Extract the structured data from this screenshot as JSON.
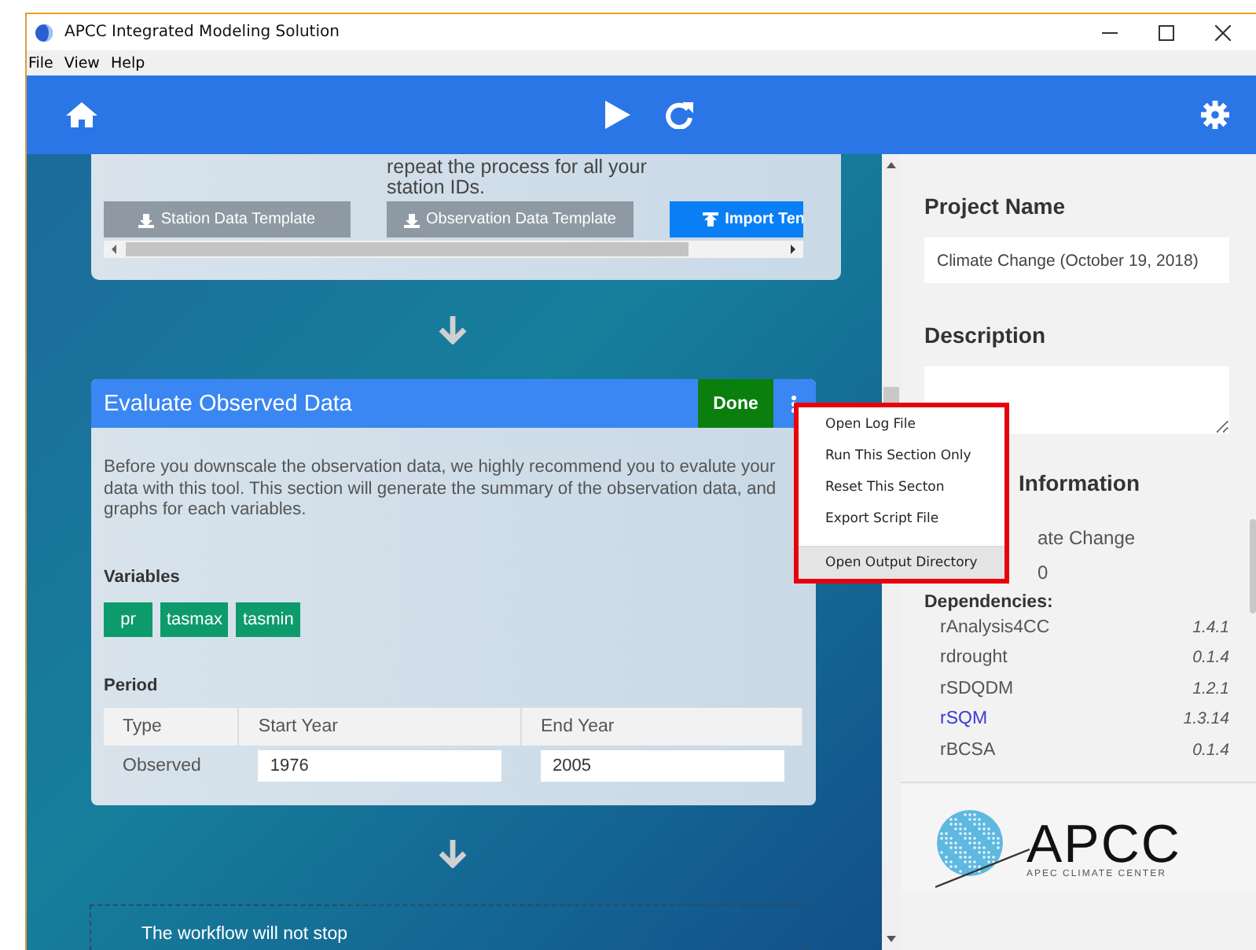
{
  "window": {
    "title": "APCC Integrated Modeling Solution"
  },
  "menu_bar": [
    "File",
    "View",
    "Help"
  ],
  "workflow": {
    "top_card": {
      "text": "repeat the process for all your station IDs.",
      "buttons": [
        {
          "label": "Station Data Template",
          "disabled": true
        },
        {
          "label": "Observation Data Template",
          "disabled": true
        },
        {
          "label": "Import Ten",
          "disabled": false
        }
      ]
    },
    "section": {
      "title": "Evaluate Observed Data",
      "status": "Done",
      "description": "Before you downscale the observation data, we highly recommend you to evalute your data with this tool. This section will generate the summary of the observation data, and graphs for each variables.",
      "variables_label": "Variables",
      "variables": [
        "pr",
        "tasmax",
        "tasmin"
      ],
      "period_label": "Period",
      "period_table": {
        "columns": [
          "Type",
          "Start Year",
          "End Year"
        ],
        "rows": [
          {
            "type": "Observed",
            "start_year": "1976",
            "end_year": "2005"
          }
        ]
      }
    },
    "next_card": {
      "text": "The workflow will not stop"
    }
  },
  "context_menu": {
    "items": [
      {
        "label": "Open Log File",
        "separated": false,
        "highlighted": false
      },
      {
        "label": "Run This Section Only",
        "separated": false,
        "highlighted": false
      },
      {
        "label": "Reset This Secton",
        "separated": false,
        "highlighted": false
      },
      {
        "label": "Export Script File",
        "separated": false,
        "highlighted": false
      },
      {
        "label": "Open Output Directory",
        "separated": true,
        "highlighted": true
      }
    ]
  },
  "project_panel": {
    "name_label": "Project Name",
    "name_value": "Climate Change (October 19, 2018)",
    "description_label": "Description",
    "info_heading": "Information",
    "info_lines": [
      "ate Change",
      "0"
    ],
    "dependencies_label": "Dependencies:",
    "dependencies": [
      {
        "name": "rAnalysis4CC",
        "version": "1.4.1",
        "link": false
      },
      {
        "name": "rdrought",
        "version": "0.1.4",
        "link": false
      },
      {
        "name": "rSDQDM",
        "version": "1.2.1",
        "link": false
      },
      {
        "name": "rSQM",
        "version": "1.3.14",
        "link": true
      },
      {
        "name": "rBCSA",
        "version": "0.1.4",
        "link": false
      }
    ]
  },
  "logo": {
    "name": "APCC",
    "subtitle": "APEC CLIMATE CENTER"
  }
}
